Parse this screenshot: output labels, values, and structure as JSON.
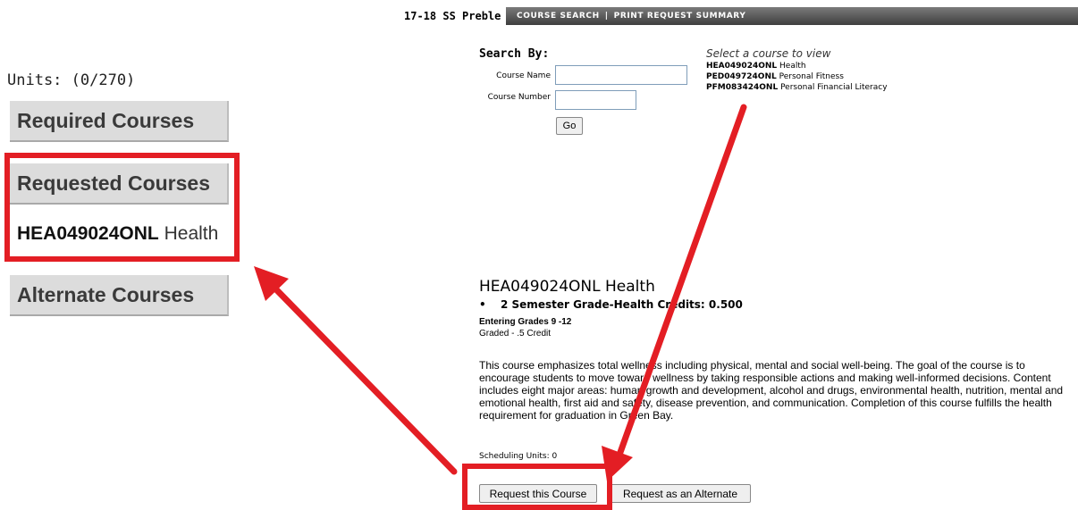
{
  "left_panel": {
    "units": "Units: (0/270)",
    "required_label": "Required Courses",
    "requested_label": "Requested Courses",
    "requested_item_code": "HEA049024ONL",
    "requested_item_name": "Health",
    "alternate_label": "Alternate Courses"
  },
  "nav": {
    "school": "17-18 SS Preble",
    "course_search": "COURSE SEARCH",
    "separator": "|",
    "print_summary": "PRINT REQUEST SUMMARY"
  },
  "search": {
    "title": "Search By:",
    "course_name_label": "Course Name",
    "course_number_label": "Course Number",
    "course_name_value": "",
    "course_number_value": "",
    "go_label": "Go"
  },
  "select": {
    "title": "Select a course to view",
    "courses": [
      {
        "code": "HEA049024ONL",
        "name": "Health"
      },
      {
        "code": "PED049724ONL",
        "name": "Personal Fitness"
      },
      {
        "code": "PFM083424ONL",
        "name": "Personal Financial Literacy"
      }
    ]
  },
  "course": {
    "title": "HEA049024ONL Health",
    "bullet": "2 Semester Grade-Health Credits: 0.500",
    "grades": "Entering Grades 9 -12",
    "graded": "Graded - .5 Credit",
    "description": "This course emphasizes total wellness including physical, mental and social well-being. The goal of the course is to encourage students to move toward wellness by taking responsible actions and making well-informed decisions. Content includes eight major areas: human growth and development, alcohol and drugs, environmental health, nutrition, mental and emotional health, first aid and safety, disease prevention, and communication. Completion of this course fulfills the health requirement for graduation in Green Bay.",
    "scheduling_units": "Scheduling Units: 0",
    "request_label": "Request this Course",
    "alternate_label": "Request as an Alternate"
  },
  "colors": {
    "highlight": "#e31e24",
    "nav_bar": "#4a4a4a",
    "panel_box": "#dcdcdc"
  }
}
